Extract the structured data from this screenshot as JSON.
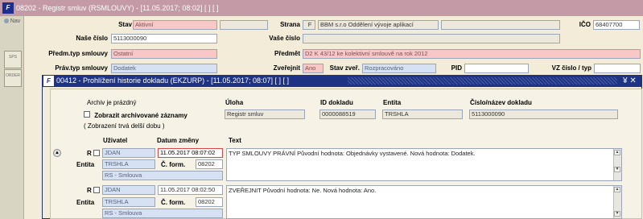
{
  "window": {
    "logo": "F",
    "title": "08202 - Registr smluv (RSMLOUVY) - [11.05.2017; 08:02] [ ] [ ]"
  },
  "nav": {
    "label": "Nav"
  },
  "side_buttons": [
    "SPS",
    "ORDER"
  ],
  "form": {
    "stav_label": "Stav",
    "stav_value": "Aktivní",
    "strana_label": "Strana",
    "strana_code": "F",
    "strana_value": "BBM s.r.o Oddělení vývoje aplikací",
    "ico_label": "IČO",
    "ico_value": "68407700",
    "nase_cislo_label": "Naše číslo",
    "nase_cislo_value": "5113000090",
    "vase_cislo_label": "Vaše číslo",
    "vase_cislo_value": "",
    "predm_typ_label": "Předm.typ smlouvy",
    "predm_typ_value": "Ostatní",
    "predmet_label": "Předmět",
    "predmet_value": "D2 K 43/12  ke kolektivní smlouvě na rok 2012",
    "prav_typ_label": "Práv.typ smlouvy",
    "prav_typ_value": "Dodatek",
    "zverejnit_label": "Zveřejnit",
    "zverejnit_value": "Ano",
    "stav_zver_label": "Stav zveř.",
    "stav_zver_value": "Rozpracováno",
    "pid_label": "PID",
    "pid_value": "",
    "vz_label": "VZ číslo / typ",
    "vz_value": ""
  },
  "modal": {
    "logo": "F",
    "title": "00412 - Prohlížení historie dokladu (EKZURP) - [11.05.2017; 08:07] [ ] [ ]",
    "ctrl": "¥ ✕",
    "archive_text": "Archiv je prázdný",
    "show_archived_label": "Zobrazit archivované záznamy",
    "slow_note": "( Zobrazení trvá delší dobu )",
    "uloha_label": "Úloha",
    "uloha_value": "Registr smluv",
    "id_label": "ID dokladu",
    "id_value": "0000088519",
    "entita_label": "Entita",
    "entita_value": "TRSHLA",
    "cislo_label": "Číslo/název dokladu",
    "cislo_value": "5113000090",
    "col_user": "Uživatel",
    "col_date": "Datum změny",
    "col_text": "Text",
    "records": [
      {
        "r_label": "R",
        "user": "JDAN",
        "date": "11.05.2017 08:07:02",
        "entita_label": "Entita",
        "entita": "TRSHLA",
        "cform_label": "Č. form.",
        "cform": "08202",
        "module": "RS - Smlouva",
        "text": "TYP SMLOUVY PRÁVNÍ Původní hodnota: Objednávky vystavené.    Nová hodnota: Dodatek."
      },
      {
        "r_label": "R",
        "user": "JDAN",
        "date": "11.05.2017 08:02:50",
        "entita_label": "Entita",
        "entita": "TRSHLA",
        "cform_label": "Č. form.",
        "cform": "08202",
        "module": "RS - Smlouva",
        "text": "ZVEŘEJNIT Původní hodnota: Ne.    Nová hodnota: Ano."
      }
    ]
  }
}
